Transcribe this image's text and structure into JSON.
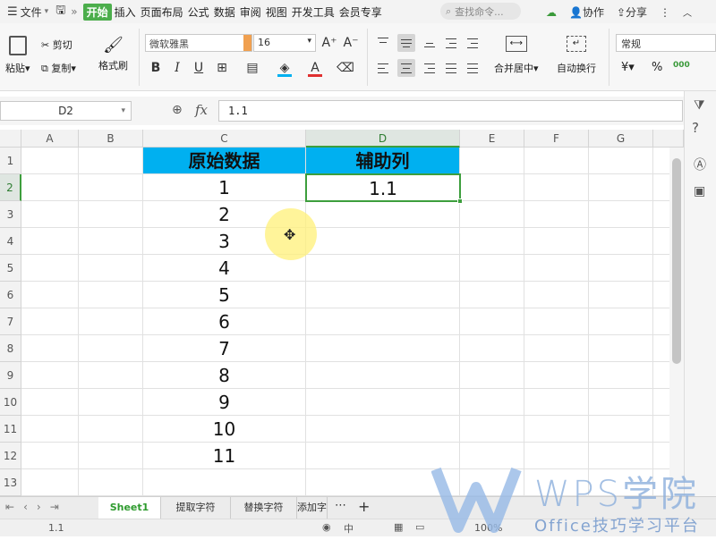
{
  "menubar": {
    "file": "文件",
    "tabs": [
      "开始",
      "插入",
      "页面布局",
      "公式",
      "数据",
      "审阅",
      "视图",
      "开发工具",
      "会员专享"
    ],
    "active_tab": "开始",
    "search": "查找命令...",
    "collab": "协作",
    "share": "分享"
  },
  "ribbon": {
    "paste": "粘贴",
    "cut": "剪切",
    "copy": "复制",
    "format_painter": "格式刷",
    "font_name": "微软雅黑",
    "font_size": "16",
    "bold": "B",
    "italic": "I",
    "underline": "U",
    "merge_center": "合并居中",
    "wrap": "自动换行",
    "number_format": "常规",
    "currency": "¥",
    "percent": "%",
    "thousands": "000",
    "font_color": "#e03030",
    "fill_color": "#00b0f0"
  },
  "formula": {
    "cell_ref": "D2",
    "fx": "fx",
    "value": "1.1"
  },
  "columns": [
    "A",
    "B",
    "C",
    "D",
    "E",
    "F",
    "G"
  ],
  "selected_column": "D",
  "selected_row": "2",
  "rows": [
    "1",
    "2",
    "3",
    "4",
    "5",
    "6",
    "7",
    "8",
    "9",
    "10",
    "11",
    "12",
    "13"
  ],
  "table": {
    "header_c": "原始数据",
    "header_d": "辅助列",
    "c_values": [
      "1",
      "2",
      "3",
      "4",
      "5",
      "6",
      "7",
      "8",
      "9",
      "10",
      "11"
    ],
    "d_values": [
      "1.1"
    ],
    "header_fill": "#00b0f0"
  },
  "sheet_tabs": [
    "Sheet1",
    "提取字符",
    "替换字符",
    "添加字"
  ],
  "active_sheet": "Sheet1",
  "status": {
    "value": "1.1",
    "zoom": "100%"
  },
  "watermark": {
    "title": "WPS学院",
    "subtitle": "Office技巧学习平台"
  }
}
